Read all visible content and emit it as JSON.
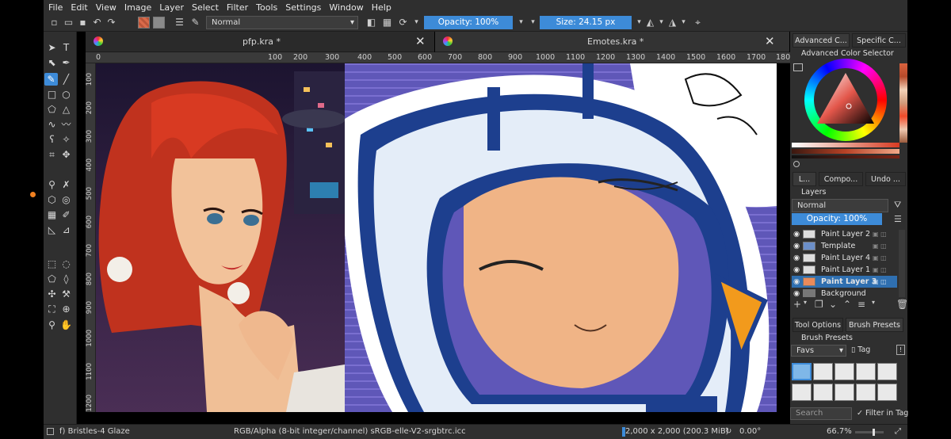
{
  "menu": [
    "File",
    "Edit",
    "View",
    "Image",
    "Layer",
    "Select",
    "Filter",
    "Tools",
    "Settings",
    "Window",
    "Help"
  ],
  "toolbar": {
    "blend_mode": "Normal",
    "opacity": "Opacity: 100%",
    "size": "Size: 24.15 px"
  },
  "documents": [
    {
      "title": "pfp.kra *",
      "close": "✕"
    },
    {
      "title": "Emotes.kra *",
      "close": "✕"
    }
  ],
  "ruler_left": [
    "0",
    "100",
    "200",
    "300"
  ],
  "ruler_right": [
    "400",
    "500",
    "600",
    "700",
    "800",
    "900",
    "1000",
    "1100",
    "1200",
    "1300",
    "1400",
    "1500",
    "1600",
    "1700",
    "180"
  ],
  "ruler_v": [
    "100",
    "200",
    "300",
    "400",
    "500",
    "600",
    "700",
    "800",
    "900",
    "1000",
    "1100",
    "1200"
  ],
  "dock": {
    "tabs_top": [
      "Advanced C...",
      "Specific C..."
    ],
    "color_selector_title": "Advanced Color Selector",
    "tabs_mid": [
      "L...",
      "Compo...",
      "Undo ..."
    ],
    "layers_title": "Layers",
    "layers_blend": "Normal",
    "layers_opacity": "Opacity:  100%",
    "layers": [
      {
        "name": "Paint Layer 2",
        "active": false
      },
      {
        "name": "Template",
        "active": false
      },
      {
        "name": "Paint Layer 4",
        "active": false
      },
      {
        "name": "Paint Layer 1",
        "active": false
      },
      {
        "name": "Paint Layer 3",
        "active": true
      },
      {
        "name": "Background",
        "active": false
      }
    ],
    "tabs_bottom": [
      "Tool Options",
      "Brush Presets"
    ],
    "brush_presets_title": "Brush Presets",
    "brush_tag": "Favs",
    "tag_label": "Tag",
    "search_placeholder": "Search",
    "filter_in_tag": "Filter in Tag"
  },
  "status": {
    "brush": "f) Bristles-4 Glaze",
    "color_space": "RGB/Alpha (8-bit integer/channel)  sRGB-elle-V2-srgbtrc.icc",
    "image_size": "2,000 x 2,000 (200.3 MiB)",
    "rotation": "0.00°",
    "zoom": "66.7%"
  },
  "colors": {
    "accent": "#3d8bd8",
    "panel": "#2f2f2f",
    "active_layer": "#2f6fb0"
  }
}
